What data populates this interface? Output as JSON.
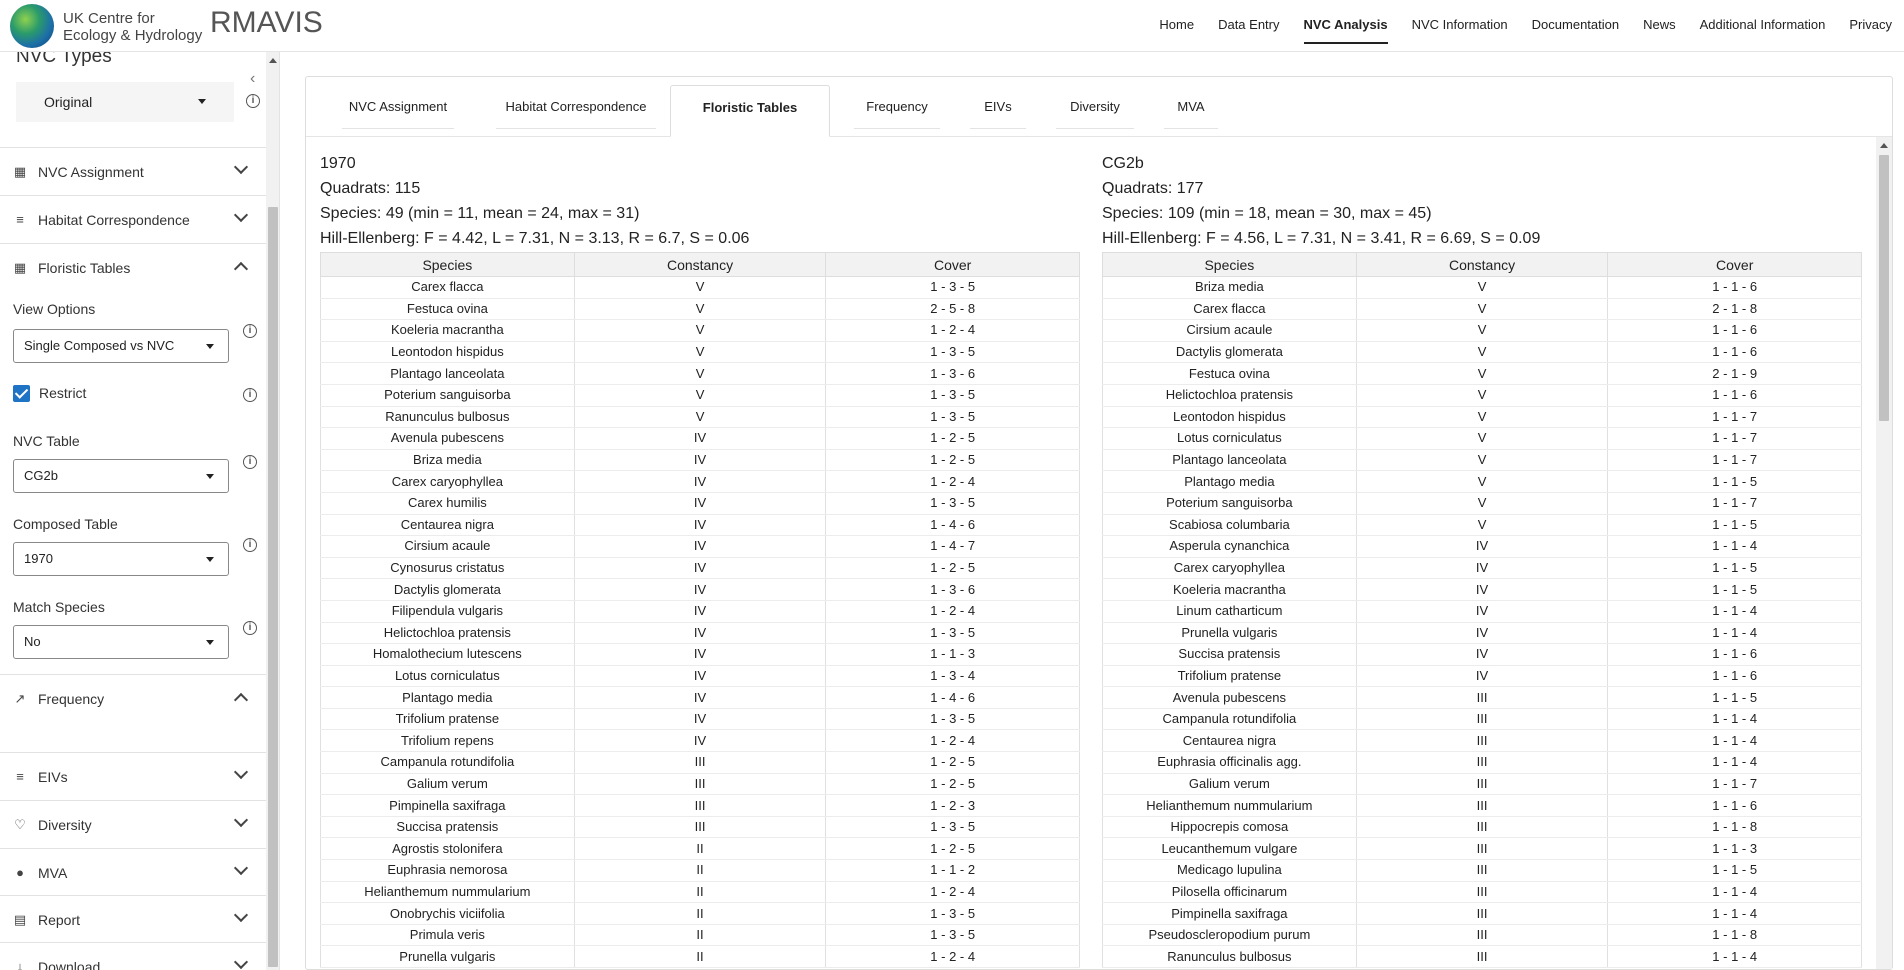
{
  "header": {
    "logo_line1": "UK Centre for",
    "logo_line2": "Ecology & Hydrology",
    "app_title": "RMAVIS",
    "nav": [
      "Home",
      "Data Entry",
      "NVC Analysis",
      "NVC Information",
      "Documentation",
      "News",
      "Additional Information",
      "Privacy"
    ],
    "active_nav": "NVC Analysis"
  },
  "sidebar": {
    "nvc_types_title": "NVC Types",
    "nvc_types_value": "Original",
    "sections": {
      "nvc_assignment": "NVC Assignment",
      "habitat_correspondence": "Habitat Correspondence",
      "floristic_tables": "Floristic Tables",
      "frequency": "Frequency",
      "eivs": "EIVs",
      "diversity": "Diversity",
      "mva": "MVA",
      "report": "Report",
      "download": "Download"
    },
    "view_options_label": "View Options",
    "view_options_value": "Single Composed vs NVC",
    "restrict_label": "Restrict",
    "restrict_checked": true,
    "nvc_table_label": "NVC Table",
    "nvc_table_value": "CG2b",
    "composed_table_label": "Composed Table",
    "composed_table_value": "1970",
    "match_species_label": "Match Species",
    "match_species_value": "No"
  },
  "tabs": [
    "NVC Assignment",
    "Habitat Correspondence",
    "Floristic Tables",
    "Frequency",
    "EIVs",
    "Diversity",
    "MVA"
  ],
  "active_tab": "Floristic Tables",
  "columns": [
    "Species",
    "Constancy",
    "Cover"
  ],
  "left_table": {
    "title": "1970",
    "quadrats": "Quadrats: 115",
    "species": "Species: 49 (min = 11, mean = 24, max = 31)",
    "hill_ellenberg": "Hill-Ellenberg: F = 4.42, L = 7.31, N = 3.13, R = 6.7, S = 0.06",
    "rows": [
      [
        "Carex flacca",
        "V",
        "1 - 3 - 5"
      ],
      [
        "Festuca ovina",
        "V",
        "2 - 5 - 8"
      ],
      [
        "Koeleria macrantha",
        "V",
        "1 - 2 - 4"
      ],
      [
        "Leontodon hispidus",
        "V",
        "1 - 3 - 5"
      ],
      [
        "Plantago lanceolata",
        "V",
        "1 - 3 - 6"
      ],
      [
        "Poterium sanguisorba",
        "V",
        "1 - 3 - 5"
      ],
      [
        "Ranunculus bulbosus",
        "V",
        "1 - 3 - 5"
      ],
      [
        "Avenula pubescens",
        "IV",
        "1 - 2 - 5"
      ],
      [
        "Briza media",
        "IV",
        "1 - 2 - 5"
      ],
      [
        "Carex caryophyllea",
        "IV",
        "1 - 2 - 4"
      ],
      [
        "Carex humilis",
        "IV",
        "1 - 3 - 5"
      ],
      [
        "Centaurea nigra",
        "IV",
        "1 - 4 - 6"
      ],
      [
        "Cirsium acaule",
        "IV",
        "1 - 4 - 7"
      ],
      [
        "Cynosurus cristatus",
        "IV",
        "1 - 2 - 5"
      ],
      [
        "Dactylis glomerata",
        "IV",
        "1 - 3 - 6"
      ],
      [
        "Filipendula vulgaris",
        "IV",
        "1 - 2 - 4"
      ],
      [
        "Helictochloa pratensis",
        "IV",
        "1 - 3 - 5"
      ],
      [
        "Homalothecium lutescens",
        "IV",
        "1 - 1 - 3"
      ],
      [
        "Lotus corniculatus",
        "IV",
        "1 - 3 - 4"
      ],
      [
        "Plantago media",
        "IV",
        "1 - 4 - 6"
      ],
      [
        "Trifolium pratense",
        "IV",
        "1 - 3 - 5"
      ],
      [
        "Trifolium repens",
        "IV",
        "1 - 2 - 4"
      ],
      [
        "Campanula rotundifolia",
        "III",
        "1 - 2 - 5"
      ],
      [
        "Galium verum",
        "III",
        "1 - 2 - 5"
      ],
      [
        "Pimpinella saxifraga",
        "III",
        "1 - 2 - 3"
      ],
      [
        "Succisa pratensis",
        "III",
        "1 - 3 - 5"
      ],
      [
        "Agrostis stolonifera",
        "II",
        "1 - 2 - 5"
      ],
      [
        "Euphrasia nemorosa",
        "II",
        "1 - 1 - 2"
      ],
      [
        "Helianthemum nummularium",
        "II",
        "1 - 2 - 4"
      ],
      [
        "Onobrychis viciifolia",
        "II",
        "1 - 3 - 5"
      ],
      [
        "Primula veris",
        "II",
        "1 - 3 - 5"
      ],
      [
        "Prunella vulgaris",
        "II",
        "1 - 2 - 4"
      ]
    ]
  },
  "right_table": {
    "title": "CG2b",
    "quadrats": "Quadrats: 177",
    "species": "Species: 109 (min = 18, mean = 30, max = 45)",
    "hill_ellenberg": "Hill-Ellenberg: F = 4.56, L = 7.31, N = 3.41, R = 6.69, S = 0.09",
    "rows": [
      [
        "Briza media",
        "V",
        "1 - 1 - 6"
      ],
      [
        "Carex flacca",
        "V",
        "2 - 1 - 8"
      ],
      [
        "Cirsium acaule",
        "V",
        "1 - 1 - 6"
      ],
      [
        "Dactylis glomerata",
        "V",
        "1 - 1 - 6"
      ],
      [
        "Festuca ovina",
        "V",
        "2 - 1 - 9"
      ],
      [
        "Helictochloa pratensis",
        "V",
        "1 - 1 - 6"
      ],
      [
        "Leontodon hispidus",
        "V",
        "1 - 1 - 7"
      ],
      [
        "Lotus corniculatus",
        "V",
        "1 - 1 - 7"
      ],
      [
        "Plantago lanceolata",
        "V",
        "1 - 1 - 7"
      ],
      [
        "Plantago media",
        "V",
        "1 - 1 - 5"
      ],
      [
        "Poterium sanguisorba",
        "V",
        "1 - 1 - 7"
      ],
      [
        "Scabiosa columbaria",
        "V",
        "1 - 1 - 5"
      ],
      [
        "Asperula cynanchica",
        "IV",
        "1 - 1 - 4"
      ],
      [
        "Carex caryophyllea",
        "IV",
        "1 - 1 - 5"
      ],
      [
        "Koeleria macrantha",
        "IV",
        "1 - 1 - 5"
      ],
      [
        "Linum catharticum",
        "IV",
        "1 - 1 - 4"
      ],
      [
        "Prunella vulgaris",
        "IV",
        "1 - 1 - 4"
      ],
      [
        "Succisa pratensis",
        "IV",
        "1 - 1 - 6"
      ],
      [
        "Trifolium pratense",
        "IV",
        "1 - 1 - 6"
      ],
      [
        "Avenula pubescens",
        "III",
        "1 - 1 - 5"
      ],
      [
        "Campanula rotundifolia",
        "III",
        "1 - 1 - 4"
      ],
      [
        "Centaurea nigra",
        "III",
        "1 - 1 - 4"
      ],
      [
        "Euphrasia officinalis agg.",
        "III",
        "1 - 1 - 4"
      ],
      [
        "Galium verum",
        "III",
        "1 - 1 - 7"
      ],
      [
        "Helianthemum nummularium",
        "III",
        "1 - 1 - 6"
      ],
      [
        "Hippocrepis comosa",
        "III",
        "1 - 1 - 8"
      ],
      [
        "Leucanthemum vulgare",
        "III",
        "1 - 1 - 3"
      ],
      [
        "Medicago lupulina",
        "III",
        "1 - 1 - 5"
      ],
      [
        "Pilosella officinarum",
        "III",
        "1 - 1 - 4"
      ],
      [
        "Pimpinella saxifraga",
        "III",
        "1 - 1 - 4"
      ],
      [
        "Pseudoscleropodium purum",
        "III",
        "1 - 1 - 8"
      ],
      [
        "Ranunculus bulbosus",
        "III",
        "1 - 1 - 4"
      ]
    ]
  }
}
